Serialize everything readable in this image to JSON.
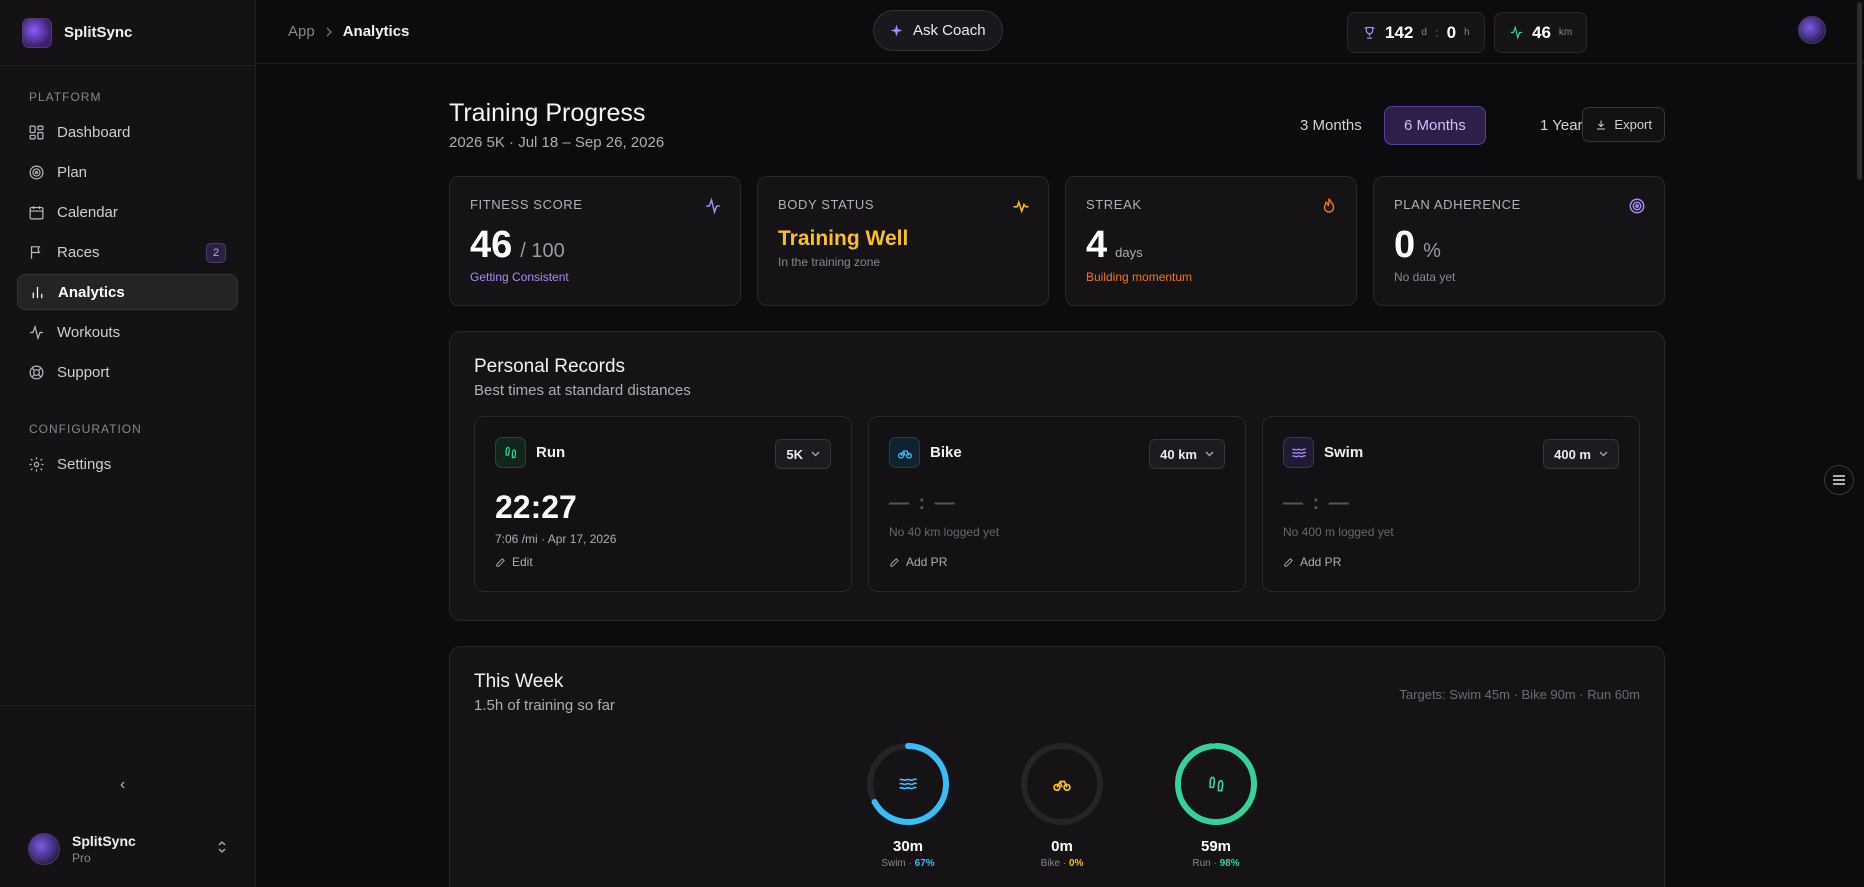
{
  "app": {
    "name": "SplitSync"
  },
  "sidebar": {
    "section_platform": "Platform",
    "section_config": "Configuration",
    "items": [
      {
        "label": "Dashboard",
        "icon": "grid-icon"
      },
      {
        "label": "Plan",
        "icon": "target-icon"
      },
      {
        "label": "Calendar",
        "icon": "calendar-icon"
      },
      {
        "label": "Races",
        "icon": "flag-icon",
        "badge": "2"
      },
      {
        "label": "Analytics",
        "icon": "bar-chart-icon",
        "active": true
      },
      {
        "label": "Workouts",
        "icon": "activity-icon"
      },
      {
        "label": "Support",
        "icon": "lifebuoy-icon"
      }
    ],
    "config_items": [
      {
        "label": "Settings",
        "icon": "gear-icon"
      }
    ],
    "collapse_glyph": "‹",
    "user": {
      "name": "SplitSync",
      "plan": "Pro"
    }
  },
  "topbar": {
    "breadcrumb_root": "App",
    "breadcrumb_current": "Analytics",
    "ask_coach": "Ask Coach",
    "streak_days": "142",
    "streak_days_unit": "d",
    "streak_sep": ":",
    "streak_hours": "0",
    "streak_hours_unit": "h",
    "distance": "46",
    "distance_unit": "km"
  },
  "header": {
    "title": "Training Progress",
    "subtitle": "2026 5K · Jul 18 – Sep 26, 2026",
    "ranges": [
      "3 Months",
      "6 Months",
      "1 Year"
    ],
    "active_range": "6 Months",
    "export_label": "Export"
  },
  "metrics": [
    {
      "label": "Fitness Score",
      "value": "46",
      "suffix": "/ 100",
      "note": "Getting Consistent",
      "note_color": "#a78bfa",
      "icon": "activity-icon",
      "icon_color": "#a78bfa"
    },
    {
      "label": "Body Status",
      "value": "Training Well",
      "note": "In the training zone",
      "note_color": "#8a8690",
      "icon": "pulse-icon",
      "icon_color": "#fbbf24"
    },
    {
      "label": "Streak",
      "value": "4",
      "suffix": "days",
      "note": "Building momentum",
      "note_color": "#f97316",
      "icon": "flame-icon",
      "icon_color": "#f97316"
    },
    {
      "label": "Plan Adherence",
      "value": "0",
      "suffix": "%",
      "note": "No data yet",
      "note_color": "#8a8690",
      "icon": "target-icon",
      "icon_color": "#a78bfa"
    }
  ],
  "records": {
    "title": "Personal Records",
    "subtitle": "Best times at standard distances",
    "items": [
      {
        "sport": "Run",
        "distance": "5K",
        "time": "22:27",
        "meta": "7:06 /mi · Apr 17, 2026",
        "action": "Edit",
        "color": "#34d399",
        "bg": "#12261e"
      },
      {
        "sport": "Bike",
        "distance": "40 km",
        "time": "— : —",
        "meta": "No 40 km logged yet",
        "action": "Add PR",
        "color": "#38bdf8",
        "bg": "#0f2230"
      },
      {
        "sport": "Swim",
        "distance": "400 m",
        "time": "— : —",
        "meta": "No 400 m logged yet",
        "action": "Add PR",
        "color": "#a78bfa",
        "bg": "#211a33"
      }
    ]
  },
  "week": {
    "title": "This Week",
    "subtitle": "1.5h of training so far",
    "targets": "Targets: Swim 45m · Bike 90m · Run 60m",
    "rings": [
      {
        "sport": "Swim",
        "value": "30m",
        "percent_label": "67%",
        "percent": 67,
        "color": "#38bdf8",
        "icon": "waves-icon"
      },
      {
        "sport": "Bike",
        "value": "0m",
        "percent_label": "0%",
        "percent": 0,
        "color": "#fbbf24",
        "icon": "bike-icon"
      },
      {
        "sport": "Run",
        "value": "59m",
        "percent_label": "98%",
        "percent": 98,
        "color": "#34d399",
        "icon": "footprints-icon"
      }
    ]
  }
}
